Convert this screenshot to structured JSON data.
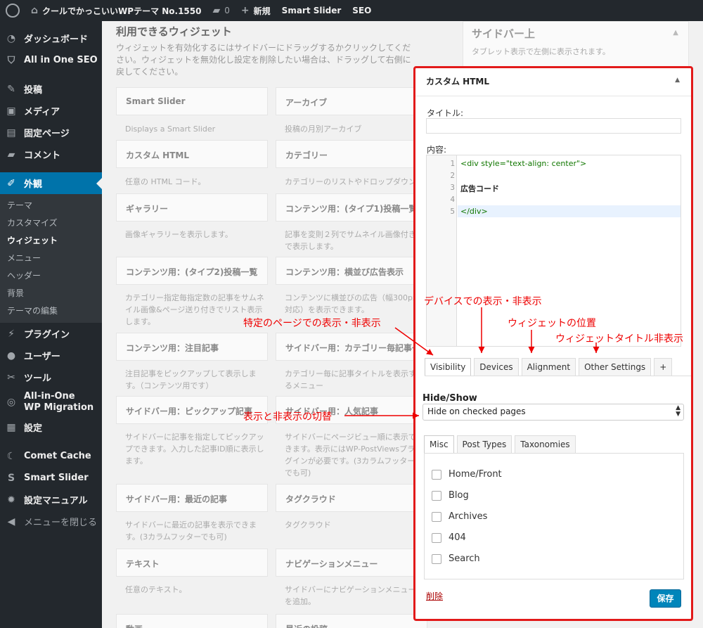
{
  "topbar": {
    "site_name": "クールでかっこいいWPテーマ No.1550",
    "comments_count": "0",
    "new_label": "新規",
    "smart_slider": "Smart Slider",
    "seo": "SEO"
  },
  "sidebar": {
    "items": [
      {
        "label": "ダッシュボード",
        "icon": "gauge-icon"
      },
      {
        "label": "All in One SEO",
        "icon": "shield-icon"
      },
      {
        "label": "投稿",
        "icon": "pin-icon"
      },
      {
        "label": "メディア",
        "icon": "media-icon"
      },
      {
        "label": "固定ページ",
        "icon": "page-icon"
      },
      {
        "label": "コメント",
        "icon": "comment-icon"
      },
      {
        "label": "外観",
        "icon": "brush-icon"
      },
      {
        "label": "プラグイン",
        "icon": "plugin-icon"
      },
      {
        "label": "ユーザー",
        "icon": "user-icon"
      },
      {
        "label": "ツール",
        "icon": "wrench-icon"
      },
      {
        "label": "All-in-One WP Migration",
        "icon": "migration-icon"
      },
      {
        "label": "設定",
        "icon": "settings-icon"
      },
      {
        "label": "Comet Cache",
        "icon": "cache-icon"
      },
      {
        "label": "Smart Slider",
        "icon": "slider-icon"
      },
      {
        "label": "設定マニュアル",
        "icon": "gear-icon"
      },
      {
        "label": "メニューを閉じる",
        "icon": "collapse-icon"
      }
    ],
    "appearance_sub": [
      "テーマ",
      "カスタマイズ",
      "ウィジェット",
      "メニュー",
      "ヘッダー",
      "背景",
      "テーマの編集"
    ]
  },
  "available": {
    "title": "利用できるウィジェット",
    "desc": "ウィジェットを有効化するにはサイドバーにドラッグするかクリックしてください。ウィジェットを無効化し設定を削除したい場合は、ドラッグして右側に戻してください。",
    "widgets": [
      {
        "title": "Smart Slider",
        "desc": "Displays a Smart Slider"
      },
      {
        "title": "アーカイブ",
        "desc": "投稿の月別アーカイブ"
      },
      {
        "title": "カスタム HTML",
        "desc": "任意の HTML コード。"
      },
      {
        "title": "カテゴリー",
        "desc": "カテゴリーのリストやドロップダウン"
      },
      {
        "title": "ギャラリー",
        "desc": "画像ギャラリーを表示します。"
      },
      {
        "title": "コンテンツ用：(タイプ1)投稿一覧",
        "desc": "記事を変則２列でサムネイル画像付きで表示します。"
      },
      {
        "title": "コンテンツ用：(タイプ2)投稿一覧",
        "desc": "カテゴリー指定毎指定数の記事をサムネイル画像&ページ送り付きでリスト表示します。"
      },
      {
        "title": "コンテンツ用：横並び広告表示",
        "desc": "コンテンツに横並びの広告（幅300px対応）を表示できます。"
      },
      {
        "title": "コンテンツ用：注目記事",
        "desc": "注目記事をピックアップして表示します。（コンテンツ用です）"
      },
      {
        "title": "サイドバー用：カテゴリー毎記事一覧",
        "desc": "カテゴリー毎に記事タイトルを表示するメニュー"
      },
      {
        "title": "サイドバー用：ピックアップ記事",
        "desc": "サイドバーに記事を指定してピックアップできます。入力した記事ID順に表示します。"
      },
      {
        "title": "サイドバー用：人気記事",
        "desc": "サイドバーにページビュー順に表示できます。表示にはWP-PostViewsプラグインが必要です。(3カラムフッターでも可)"
      },
      {
        "title": "サイドバー用：最近の記事",
        "desc": "サイドバーに最近の記事を表示できます。(3カラムフッターでも可)"
      },
      {
        "title": "タグクラウド",
        "desc": "タグクラウド"
      },
      {
        "title": "テキスト",
        "desc": "任意のテキスト。"
      },
      {
        "title": "ナビゲーションメニュー",
        "desc": "サイドバーにナビゲーションメニューを追加。"
      },
      {
        "title": "動画",
        "desc": ""
      },
      {
        "title": "最近の投稿",
        "desc": ""
      }
    ]
  },
  "right_sidebar": {
    "title": "サイドバー上",
    "desc": "タブレット表示で左側に表示されます。"
  },
  "widget_panel": {
    "title": "カスタム HTML",
    "title_label": "タイトル:",
    "title_value": "",
    "content_label": "内容:",
    "code_lines": [
      {
        "num": "1",
        "text": "<div style=\"text-align: center\">"
      },
      {
        "num": "2",
        "text": ""
      },
      {
        "num": "3",
        "text": "広告コード"
      },
      {
        "num": "4",
        "text": ""
      },
      {
        "num": "5",
        "text": "</div>"
      }
    ],
    "tabs": [
      "Visibility",
      "Devices",
      "Alignment",
      "Other Settings",
      "+"
    ],
    "hide_show_label": "Hide/Show",
    "hide_show_value": "Hide on checked pages",
    "subtabs": [
      "Misc",
      "Post Types",
      "Taxonomies"
    ],
    "checkboxes": [
      "Home/Front",
      "Blog",
      "Archives",
      "404",
      "Search"
    ],
    "delete_label": "削除",
    "save_label": "保存"
  },
  "annotations": {
    "devices": "デバイスでの表示・非表示",
    "specific_pages": "特定のページでの表示・非表示",
    "widget_position": "ウィジェットの位置",
    "title_hide": "ウィジェットタイトル非表示",
    "toggle": "表示と非表示の切替"
  },
  "colors": {
    "accent": "#0073aa",
    "annotation": "#e00000",
    "highlight_border": "#e21a1a",
    "save_button": "#0085ba"
  }
}
